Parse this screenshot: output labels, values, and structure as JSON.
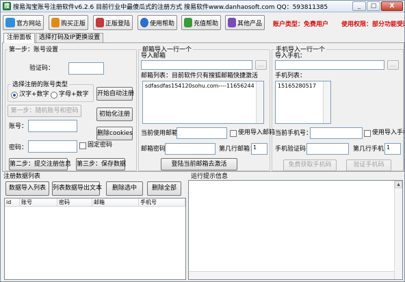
{
  "window": {
    "title": "搜易淘宝账号注册软件v6.2.6 目前行业中最傻瓜式的注册方式 搜易软件www.danhaosoft.com QQ：593811385",
    "minimize": "_",
    "maximize": "□",
    "close": "X"
  },
  "toolbar": {
    "buttons": [
      {
        "label": "官方网站",
        "icon": "home-icon",
        "color": "#2f8fdb"
      },
      {
        "label": "购买正版",
        "icon": "cart-icon",
        "color": "#e08a1a"
      },
      {
        "label": "正版登陆",
        "icon": "key-icon",
        "color": "#c33a3a"
      },
      {
        "label": "使用帮助",
        "icon": "help-icon",
        "color": "#2a6fc9"
      },
      {
        "label": "充值帮助",
        "icon": "card-icon",
        "color": "#3b9a3b"
      },
      {
        "label": "其他产品",
        "icon": "box-icon",
        "color": "#7a4cb8"
      }
    ],
    "account_type": "账户类型：免费用户",
    "permission": "使用权限：部分功能受限"
  },
  "tabs": [
    {
      "label": "注册面板",
      "active": true
    },
    {
      "label": "选择打码及IP更换设置",
      "active": false
    }
  ],
  "step1": {
    "group_label": "第一步：账号设置",
    "captcha_label": "验证码：",
    "type_group_label": "选择注册的账号类型",
    "radio_chinese": "汉字+数字",
    "radio_letters": "字母+数字",
    "random_button": "第一步：随机账号和密码",
    "account_label": "账号：",
    "password_label": "密码：",
    "fixed_password": "固定密码",
    "start_button": "开始自动注册",
    "init_button": "初始化注册",
    "delete_cookies": "删除cookies",
    "submit_button": "第二步：提交注册信息",
    "save_button": "第三步：保存数据"
  },
  "email": {
    "group_label": "邮箱导入一行一个",
    "import_label": "导入邮箱",
    "browse": "...",
    "list_label": "邮箱列表：目前软件只有搜狐邮箱快捷激活",
    "list_content": "sdfasdfas154120sohu.com----11656244",
    "current_label": "当前使用邮箱：",
    "use_import": "使用导入邮箱",
    "password_label": "邮箱密码：",
    "row_label": "第几行邮箱：",
    "row_value": "1",
    "login_button": "登陆当前邮箱去激活"
  },
  "phone": {
    "group_label": "手机导入一行一个",
    "import_label": "导入手机：",
    "browse": "...",
    "list_label": "手机列表：",
    "list_content": "15165280517",
    "current_label": "当前手机号：",
    "use_import": "使用导入手机",
    "code_label": "手机验证码：",
    "row_label": "第几行手机：",
    "row_value": "1",
    "get_code_button": "免费获取手机码",
    "verify_button": "验证手机码"
  },
  "data": {
    "group_label": "注册数据列表",
    "import_button": "数据导入列表",
    "export_button": "列表数据导出文本",
    "delete_selected": "删除选中",
    "delete_all": "删除全部",
    "columns": [
      "id",
      "账号",
      "密码",
      "邮箱",
      "手机号"
    ]
  },
  "log": {
    "group_label": "运行提示信息"
  }
}
